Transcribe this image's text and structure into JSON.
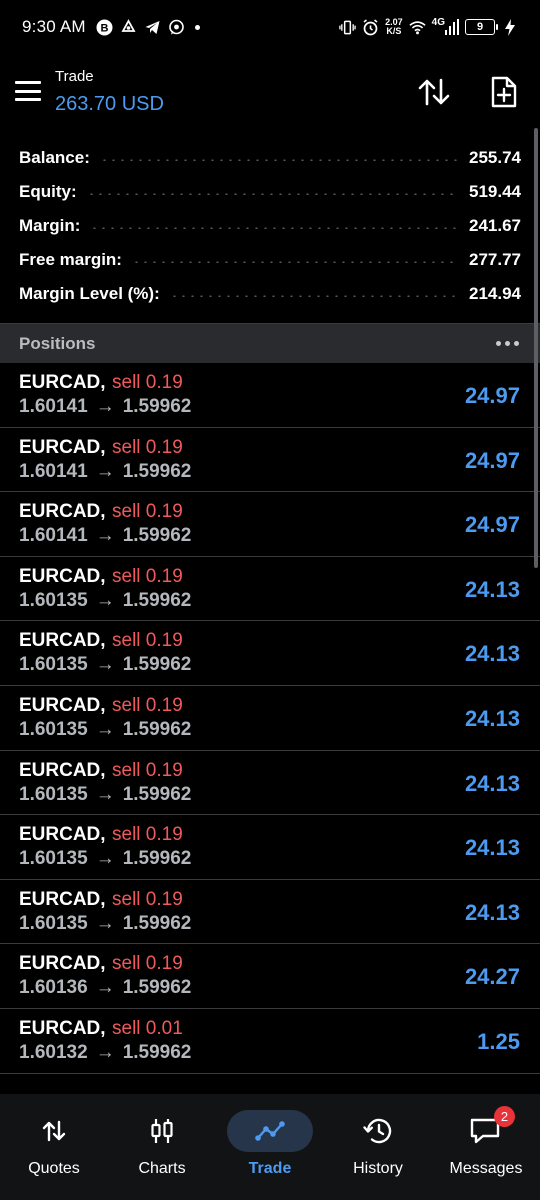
{
  "status_bar": {
    "time": "9:30 AM",
    "net_speed_value": "2.07",
    "net_speed_unit": "K/S",
    "network_type": "4G",
    "battery_level": "9",
    "left_icons": [
      "bitcoin-icon",
      "recycle-icon",
      "telegram-icon",
      "whatsapp-icon"
    ],
    "right_icons": [
      "vibrate-icon",
      "alarm-icon",
      "wifi-icon",
      "signal-icon",
      "charging-icon"
    ]
  },
  "header": {
    "title": "Trade",
    "balance_text": "263.70 USD"
  },
  "summary": [
    {
      "label": "Balance:",
      "value": "255.74"
    },
    {
      "label": "Equity:",
      "value": "519.44"
    },
    {
      "label": "Margin:",
      "value": "241.67"
    },
    {
      "label": "Free margin:",
      "value": "277.77"
    },
    {
      "label": "Margin Level (%):",
      "value": "214.94"
    }
  ],
  "positions_header": {
    "label": "Positions"
  },
  "positions": [
    {
      "symbol": "EURCAD,",
      "type": "sell 0.19",
      "open": "1.60141",
      "arrow": "→",
      "current": "1.59962",
      "profit": "24.97"
    },
    {
      "symbol": "EURCAD,",
      "type": "sell 0.19",
      "open": "1.60141",
      "arrow": "→",
      "current": "1.59962",
      "profit": "24.97"
    },
    {
      "symbol": "EURCAD,",
      "type": "sell 0.19",
      "open": "1.60141",
      "arrow": "→",
      "current": "1.59962",
      "profit": "24.97"
    },
    {
      "symbol": "EURCAD,",
      "type": "sell 0.19",
      "open": "1.60135",
      "arrow": "→",
      "current": "1.59962",
      "profit": "24.13"
    },
    {
      "symbol": "EURCAD,",
      "type": "sell 0.19",
      "open": "1.60135",
      "arrow": "→",
      "current": "1.59962",
      "profit": "24.13"
    },
    {
      "symbol": "EURCAD,",
      "type": "sell 0.19",
      "open": "1.60135",
      "arrow": "→",
      "current": "1.59962",
      "profit": "24.13"
    },
    {
      "symbol": "EURCAD,",
      "type": "sell 0.19",
      "open": "1.60135",
      "arrow": "→",
      "current": "1.59962",
      "profit": "24.13"
    },
    {
      "symbol": "EURCAD,",
      "type": "sell 0.19",
      "open": "1.60135",
      "arrow": "→",
      "current": "1.59962",
      "profit": "24.13"
    },
    {
      "symbol": "EURCAD,",
      "type": "sell 0.19",
      "open": "1.60135",
      "arrow": "→",
      "current": "1.59962",
      "profit": "24.13"
    },
    {
      "symbol": "EURCAD,",
      "type": "sell 0.19",
      "open": "1.60136",
      "arrow": "→",
      "current": "1.59962",
      "profit": "24.27"
    },
    {
      "symbol": "EURCAD,",
      "type": "sell 0.01",
      "open": "1.60132",
      "arrow": "→",
      "current": "1.59962",
      "profit": "1.25"
    }
  ],
  "bottom_nav": [
    {
      "label": "Quotes",
      "icon": "quotes-icon",
      "active": false
    },
    {
      "label": "Charts",
      "icon": "charts-icon",
      "active": false
    },
    {
      "label": "Trade",
      "icon": "trade-icon",
      "active": true
    },
    {
      "label": "History",
      "icon": "history-icon",
      "active": false
    },
    {
      "label": "Messages",
      "icon": "messages-icon",
      "active": false,
      "badge": "2"
    }
  ],
  "colors": {
    "accent": "#4d9bf0",
    "sell": "#ef5a5a",
    "badge": "#e5343a"
  }
}
